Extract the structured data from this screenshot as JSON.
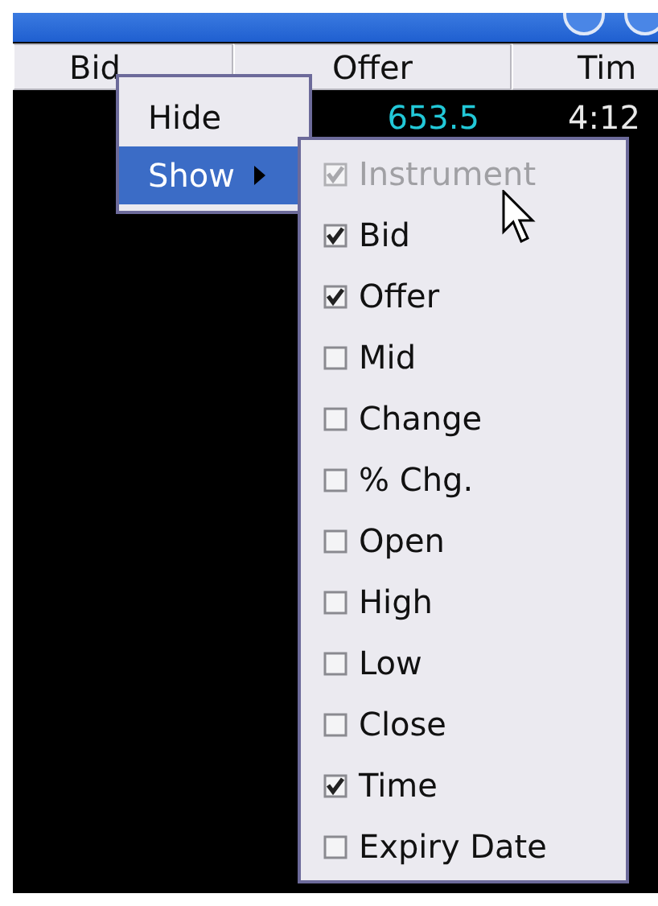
{
  "columns": [
    {
      "label": "Bid"
    },
    {
      "label": "Offer"
    },
    {
      "label": "Tim"
    }
  ],
  "rows": [
    {
      "column_2": "653.5",
      "column_3": "4:12"
    }
  ],
  "context_menu": {
    "items": [
      {
        "label": "Hide",
        "selected": false,
        "has_submenu": false
      },
      {
        "label": "Show",
        "selected": true,
        "has_submenu": true
      }
    ]
  },
  "submenu": {
    "items": [
      {
        "label": "Instrument",
        "checked": true,
        "disabled": true
      },
      {
        "label": "Bid",
        "checked": true,
        "disabled": false
      },
      {
        "label": "Offer",
        "checked": true,
        "disabled": false
      },
      {
        "label": "Mid",
        "checked": false,
        "disabled": false
      },
      {
        "label": "Change",
        "checked": false,
        "disabled": false
      },
      {
        "label": "% Chg.",
        "checked": false,
        "disabled": false
      },
      {
        "label": "Open",
        "checked": false,
        "disabled": false
      },
      {
        "label": "High",
        "checked": false,
        "disabled": false
      },
      {
        "label": "Low",
        "checked": false,
        "disabled": false
      },
      {
        "label": "Close",
        "checked": false,
        "disabled": false
      },
      {
        "label": "Time",
        "checked": true,
        "disabled": false
      },
      {
        "label": "Expiry Date",
        "checked": false,
        "disabled": false
      }
    ]
  }
}
